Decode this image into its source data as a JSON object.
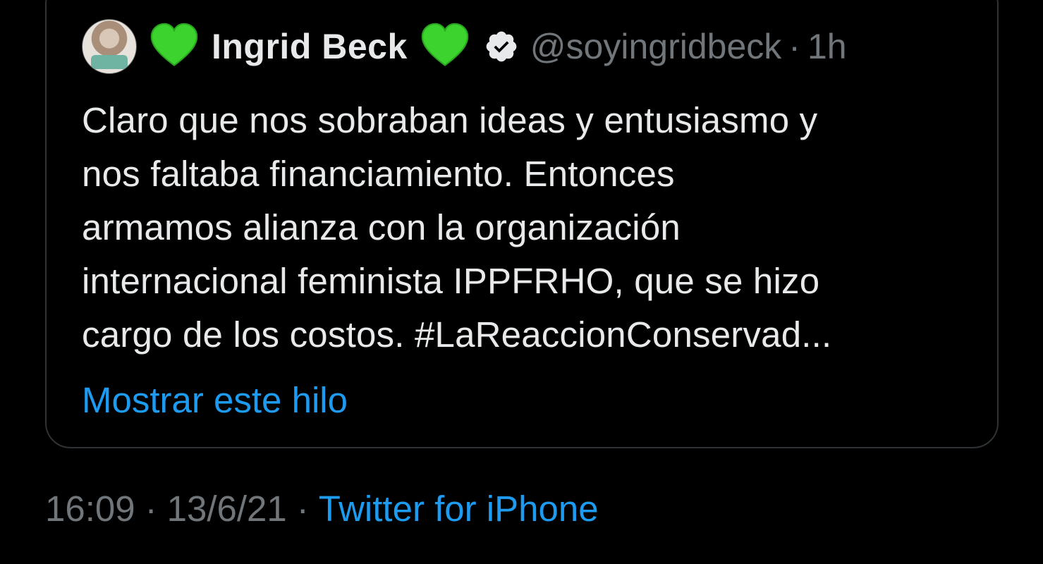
{
  "quoted_tweet": {
    "avatar_icon": "user-avatar",
    "prefix_emoji": "green-heart-icon",
    "author_name": "Ingrid Beck",
    "suffix_emoji": "green-heart-icon",
    "verified_icon": "verified-badge-icon",
    "handle": "@soyingridbeck",
    "separator": "·",
    "relative_time": "1h",
    "text_lines": [
      "Claro que nos sobraban ideas y entusiasmo y",
      "nos faltaba financiamiento. Entonces",
      "armamos alianza con la organización",
      "internacional feminista IPPFRHO, que se hizo",
      "cargo de los costos. #LaReaccionConservad..."
    ],
    "show_thread_label": "Mostrar este hilo"
  },
  "tweet_meta": {
    "time": "16:09",
    "date": "13/6/21",
    "separator": "·",
    "source": "Twitter for iPhone"
  },
  "colors": {
    "background": "#000000",
    "text": "#e7e9ea",
    "muted": "#71767b",
    "link": "#1d9bf0",
    "heart": "#3cd32e",
    "border": "#2f3336"
  }
}
